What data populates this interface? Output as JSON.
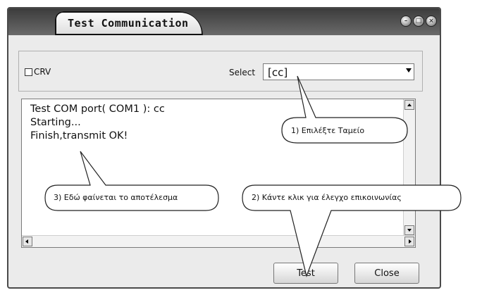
{
  "window": {
    "title": "Test Communication",
    "controls": [
      "minimize-icon",
      "maximize-icon",
      "close-icon"
    ]
  },
  "crv_checkbox": {
    "label": "CRV",
    "checked": false
  },
  "select": {
    "label": "Select",
    "value": "[cc]"
  },
  "output": {
    "lines": [
      "Test COM port( COM1 ): cc",
      "Starting...",
      "Finish,transmit OK!"
    ]
  },
  "buttons": {
    "test": "Test",
    "close": "Close"
  },
  "callouts": {
    "select_hint": "1) Επιλέξτε Ταμείο",
    "test_hint": "2) Κάντε κλικ για έλεγχο επικοινωνίας",
    "result_hint": "3) Εδώ φαίνεται το αποτέλεσμα"
  }
}
